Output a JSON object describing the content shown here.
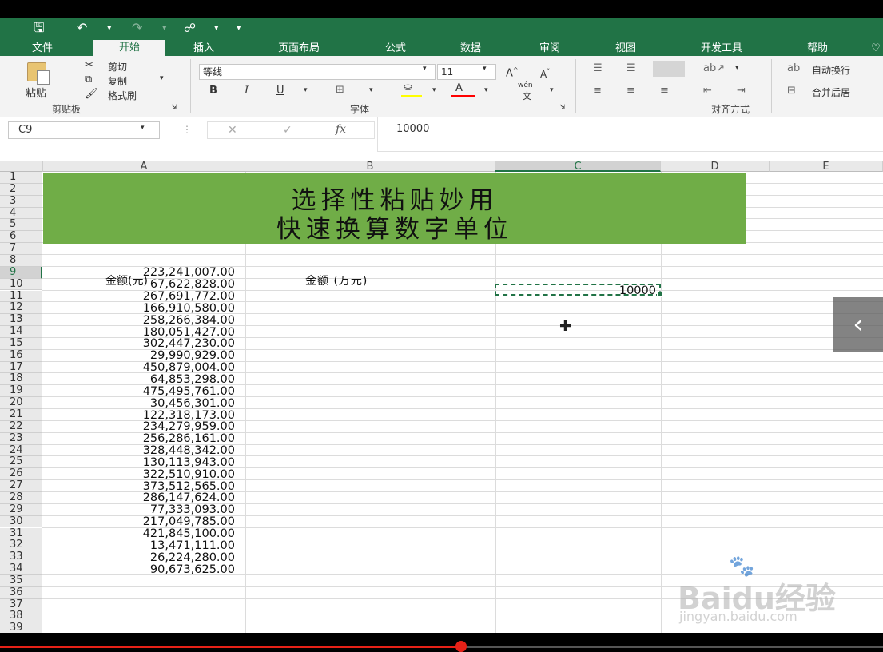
{
  "title_bar": {
    "save_icon": "save-icon",
    "undo_icon": "undo-icon",
    "redo_icon": "redo-icon",
    "touch_icon": "touch-mode-icon",
    "more": "▾"
  },
  "tabs": [
    {
      "label": "文件"
    },
    {
      "label": "开始"
    },
    {
      "label": "插入"
    },
    {
      "label": "页面布局"
    },
    {
      "label": "公式"
    },
    {
      "label": "数据"
    },
    {
      "label": "审阅"
    },
    {
      "label": "视图"
    },
    {
      "label": "开发工具"
    },
    {
      "label": "帮助"
    }
  ],
  "ribbon": {
    "clipboard": {
      "paste": "粘贴",
      "cut": "剪切",
      "copy": "复制",
      "format_painter": "格式刷",
      "group": "剪贴板"
    },
    "font": {
      "name": "等线",
      "size": "11",
      "bold": "B",
      "italic": "I",
      "underline": "U",
      "fill_color": "#ffff00",
      "font_color": "#ff0000",
      "phonetic": "wén",
      "group": "字体"
    },
    "alignment": {
      "wrap": "自动换行",
      "merge": "合并后居",
      "group": "对齐方式"
    }
  },
  "formula_bar": {
    "name_box": "C9",
    "fx": "fx",
    "value": "10000"
  },
  "columns": [
    "A",
    "B",
    "C",
    "D",
    "E"
  ],
  "rows": [
    "1",
    "2",
    "3",
    "4",
    "5",
    "6",
    "7",
    "8",
    "9",
    "10",
    "11",
    "12",
    "13",
    "14",
    "15",
    "16",
    "17",
    "18",
    "19",
    "20",
    "21",
    "22",
    "23",
    "24",
    "25",
    "26",
    "27",
    "28",
    "29",
    "30",
    "31",
    "32",
    "33",
    "34",
    "35",
    "36",
    "37",
    "38",
    "39"
  ],
  "banner": {
    "line1": "选择性粘贴妙用",
    "line2": "快速换算数字单位",
    "color": "#70ad47"
  },
  "headers": {
    "a8": "金额(元)",
    "b8": "金额 (万元)"
  },
  "amounts": [
    "223,241,007.00",
    "67,622,828.00",
    "267,691,772.00",
    "166,910,580.00",
    "258,266,384.00",
    "180,051,427.00",
    "302,447,230.00",
    "29,990,929.00",
    "450,879,004.00",
    "64,853,298.00",
    "475,495,761.00",
    "30,456,301.00",
    "122,318,173.00",
    "234,279,959.00",
    "256,286,161.00",
    "328,448,342.00",
    "130,113,943.00",
    "322,510,910.00",
    "373,512,565.00",
    "286,147,624.00",
    "77,333,093.00",
    "217,049,785.00",
    "421,845,100.00",
    "13,471,111.00",
    "26,224,280.00",
    "90,673,625.00"
  ],
  "selected_cell": {
    "ref": "C9",
    "value": "10000"
  },
  "watermark": {
    "brand": "Baidu经验",
    "url": "jingyan.baidu.com"
  },
  "player": {
    "prev_icon": "chevron-left-icon",
    "prev_glyph": "‹",
    "progress_percent": 52
  }
}
